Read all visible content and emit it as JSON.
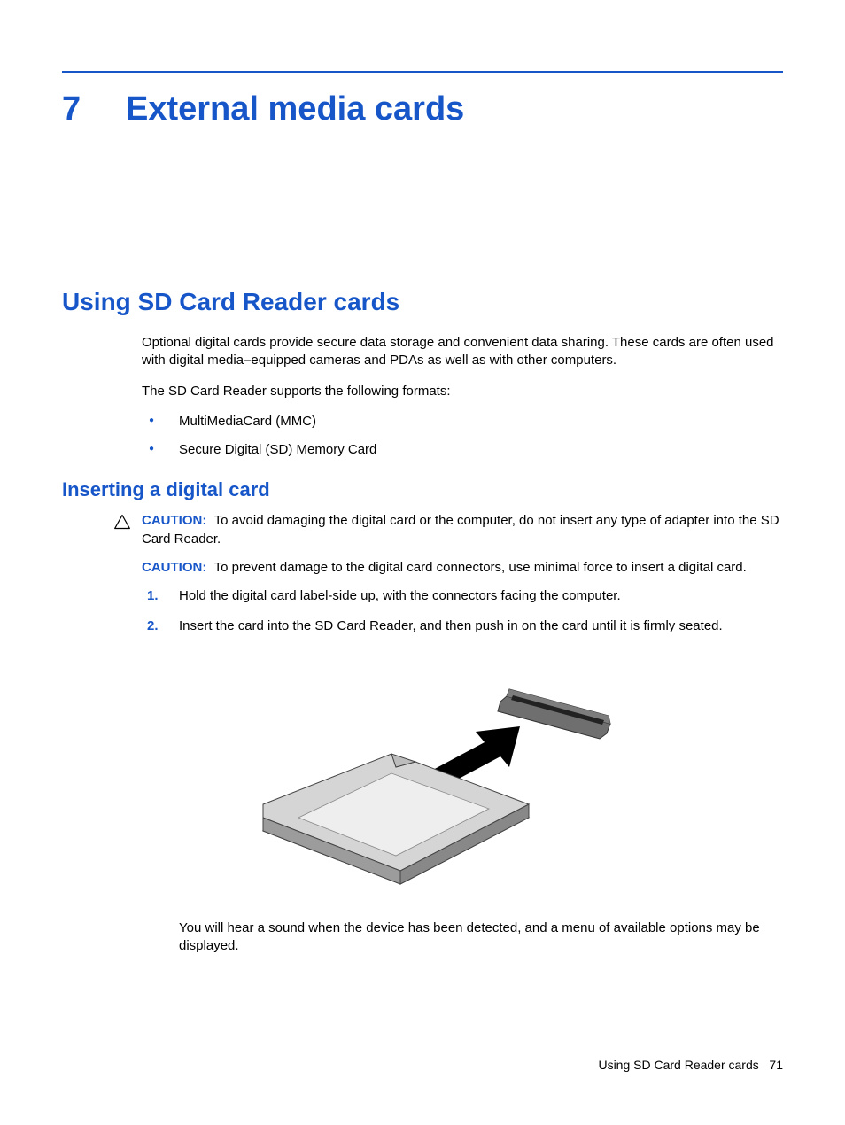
{
  "chapter": {
    "number": "7",
    "title": "External media cards"
  },
  "section": {
    "title": "Using SD Card Reader cards",
    "intro": "Optional digital cards provide secure data storage and convenient data sharing. These cards are often used with digital media–equipped cameras and PDAs as well as with other computers.",
    "supports_intro": "The SD Card Reader supports the following formats:",
    "bullets": [
      "MultiMediaCard (MMC)",
      "Secure Digital (SD) Memory Card"
    ]
  },
  "subsection": {
    "title": "Inserting a digital card",
    "caution1_label": "CAUTION:",
    "caution1_text": "To avoid damaging the digital card or the computer, do not insert any type of adapter into the SD Card Reader.",
    "caution2_label": "CAUTION:",
    "caution2_text": "To prevent damage to the digital card connectors, use minimal force to insert a digital card.",
    "steps": [
      "Hold the digital card label-side up, with the connectors facing the computer.",
      "Insert the card into the SD Card Reader, and then push in on the card until it is firmly seated."
    ],
    "post_image": "You will hear a sound when the device has been detected, and a menu of available options may be displayed."
  },
  "footer": {
    "text": "Using SD Card Reader cards",
    "page": "71"
  }
}
